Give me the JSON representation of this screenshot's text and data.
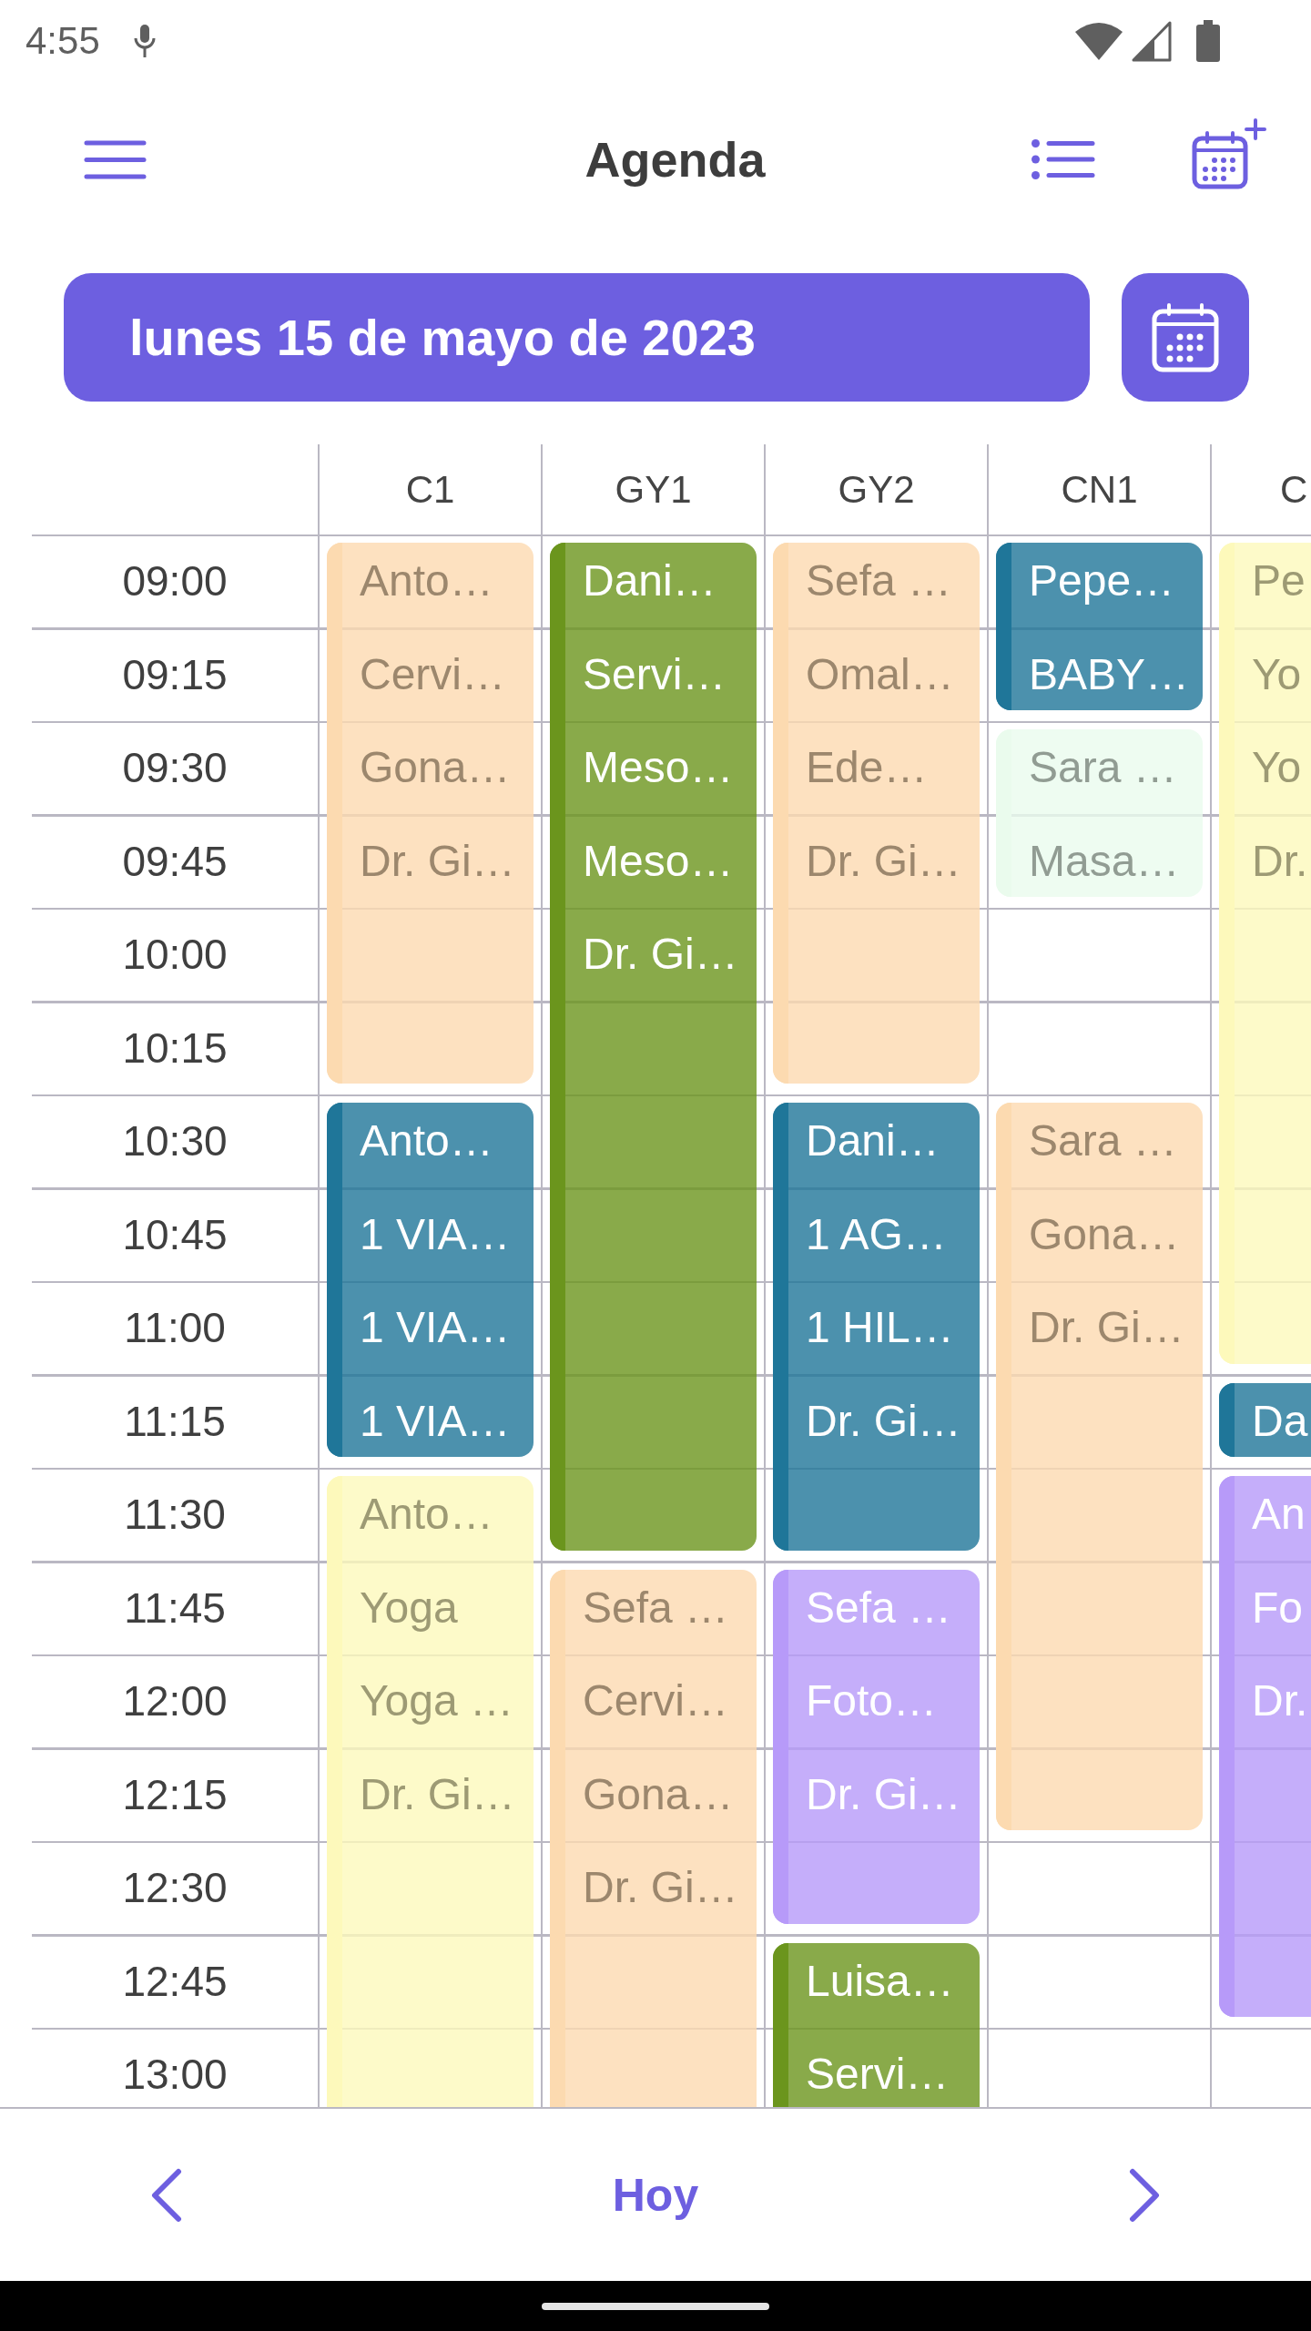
{
  "status_bar": {
    "time": "4:55"
  },
  "app_bar": {
    "title": "Agenda"
  },
  "date_bar": {
    "date": "lunes 15 de mayo de 2023"
  },
  "schedule": {
    "times": [
      "09:00",
      "09:15",
      "09:30",
      "09:45",
      "10:00",
      "10:15",
      "10:30",
      "10:45",
      "11:00",
      "11:15",
      "11:30",
      "11:45",
      "12:00",
      "12:15",
      "12:30",
      "12:45",
      "13:00"
    ],
    "columns": [
      {
        "label": "C1",
        "slots": [
          {
            "kind": "start",
            "color": "#fcdab0",
            "text": "Anto…"
          },
          {
            "kind": "continue",
            "text": "Cervi…"
          },
          {
            "kind": "continue",
            "text": "Gona…"
          },
          {
            "kind": "continue",
            "text": "Dr. Gi…"
          },
          {
            "kind": "continue"
          },
          {
            "kind": "continue"
          },
          {
            "kind": "start",
            "color": "#1f7699",
            "text": "Anto…"
          },
          {
            "kind": "continue",
            "text": "1 VIA…"
          },
          {
            "kind": "continue",
            "text": "1 VIA…"
          },
          {
            "kind": "continue",
            "text": "1 VIA…"
          },
          {
            "kind": "start",
            "color": "#fdf9bb",
            "text": "Anto…"
          },
          {
            "kind": "continue",
            "text": "Yoga"
          },
          {
            "kind": "continue",
            "text": "Yoga …"
          },
          {
            "kind": "continue",
            "text": "Dr. Gi…"
          },
          {
            "kind": "continue"
          },
          {
            "kind": "continue"
          },
          {
            "kind": "continue"
          }
        ]
      },
      {
        "label": "GY1",
        "slots": [
          {
            "kind": "start",
            "color": "#6b951d",
            "text": "Dani…"
          },
          {
            "kind": "continue",
            "text": "Servi…"
          },
          {
            "kind": "continue",
            "text": "Meso…"
          },
          {
            "kind": "continue",
            "text": "Meso…"
          },
          {
            "kind": "continue",
            "text": "Dr. Gi…"
          },
          {
            "kind": "continue"
          },
          {
            "kind": "continue"
          },
          {
            "kind": "continue"
          },
          {
            "kind": "continue"
          },
          {
            "kind": "continue"
          },
          {
            "kind": "continue"
          },
          {
            "kind": "start",
            "color": "#fcdab0",
            "text": "Sefa …"
          },
          {
            "kind": "continue",
            "text": "Cervi…"
          },
          {
            "kind": "continue",
            "text": "Gona…"
          },
          {
            "kind": "continue",
            "text": "Dr. Gi…"
          },
          {
            "kind": "continue"
          },
          {
            "kind": "continue"
          }
        ]
      },
      {
        "label": "GY2",
        "slots": [
          {
            "kind": "start",
            "color": "#fcdab0",
            "text": "Sefa …"
          },
          {
            "kind": "continue",
            "text": "Omal…"
          },
          {
            "kind": "continue",
            "text": "Ede…"
          },
          {
            "kind": "continue",
            "text": "Dr. Gi…"
          },
          {
            "kind": "continue"
          },
          {
            "kind": "continue"
          },
          {
            "kind": "start",
            "color": "#1f7699",
            "text": "Dani…"
          },
          {
            "kind": "continue",
            "text": "1 AG…"
          },
          {
            "kind": "continue",
            "text": "1 HIL…"
          },
          {
            "kind": "continue",
            "text": "Dr. Gi…"
          },
          {
            "kind": "continue"
          },
          {
            "kind": "start",
            "color": "#b79af9",
            "text": "Sefa …"
          },
          {
            "kind": "continue",
            "text": "Foto…"
          },
          {
            "kind": "continue",
            "text": "Dr. Gi…"
          },
          {
            "kind": "continue"
          },
          {
            "kind": "start",
            "color": "#6b951d",
            "text": "Luisa…"
          },
          {
            "kind": "continue",
            "text": "Servi…"
          }
        ]
      },
      {
        "label": "CN1",
        "slots": [
          {
            "kind": "start",
            "color": "#1f7699",
            "text": "Pepe…"
          },
          {
            "kind": "continue",
            "text": "BABY…"
          },
          {
            "kind": "start",
            "color": "#eafbed",
            "text": "Sara …"
          },
          {
            "kind": "continue",
            "text": "Masa…"
          },
          {
            "kind": "free"
          },
          {
            "kind": "free"
          },
          {
            "kind": "start",
            "color": "#fcdab0",
            "text": "Sara …"
          },
          {
            "kind": "continue",
            "text": "Gona…"
          },
          {
            "kind": "continue",
            "text": "Dr. Gi…"
          },
          {
            "kind": "continue"
          },
          {
            "kind": "continue"
          },
          {
            "kind": "continue"
          },
          {
            "kind": "continue"
          },
          {
            "kind": "continue"
          },
          {
            "kind": "free"
          },
          {
            "kind": "free"
          },
          {
            "kind": "free"
          }
        ]
      },
      {
        "label": "C",
        "slots": [
          {
            "kind": "start",
            "color": "#fdf9bb",
            "text": "Pe"
          },
          {
            "kind": "continue",
            "text": "Yo"
          },
          {
            "kind": "continue",
            "text": "Yo"
          },
          {
            "kind": "continue",
            "text": "Dr."
          },
          {
            "kind": "continue"
          },
          {
            "kind": "continue"
          },
          {
            "kind": "continue"
          },
          {
            "kind": "continue"
          },
          {
            "kind": "continue"
          },
          {
            "kind": "start",
            "color": "#1f7699",
            "text": "Da"
          },
          {
            "kind": "start",
            "color": "#b79af9",
            "text": "An"
          },
          {
            "kind": "continue",
            "text": "Fo"
          },
          {
            "kind": "continue",
            "text": "Dr."
          },
          {
            "kind": "continue"
          },
          {
            "kind": "continue"
          },
          {
            "kind": "continue"
          },
          {
            "kind": "free"
          }
        ]
      }
    ]
  },
  "bottom_bar": {
    "today": "Hoy"
  }
}
